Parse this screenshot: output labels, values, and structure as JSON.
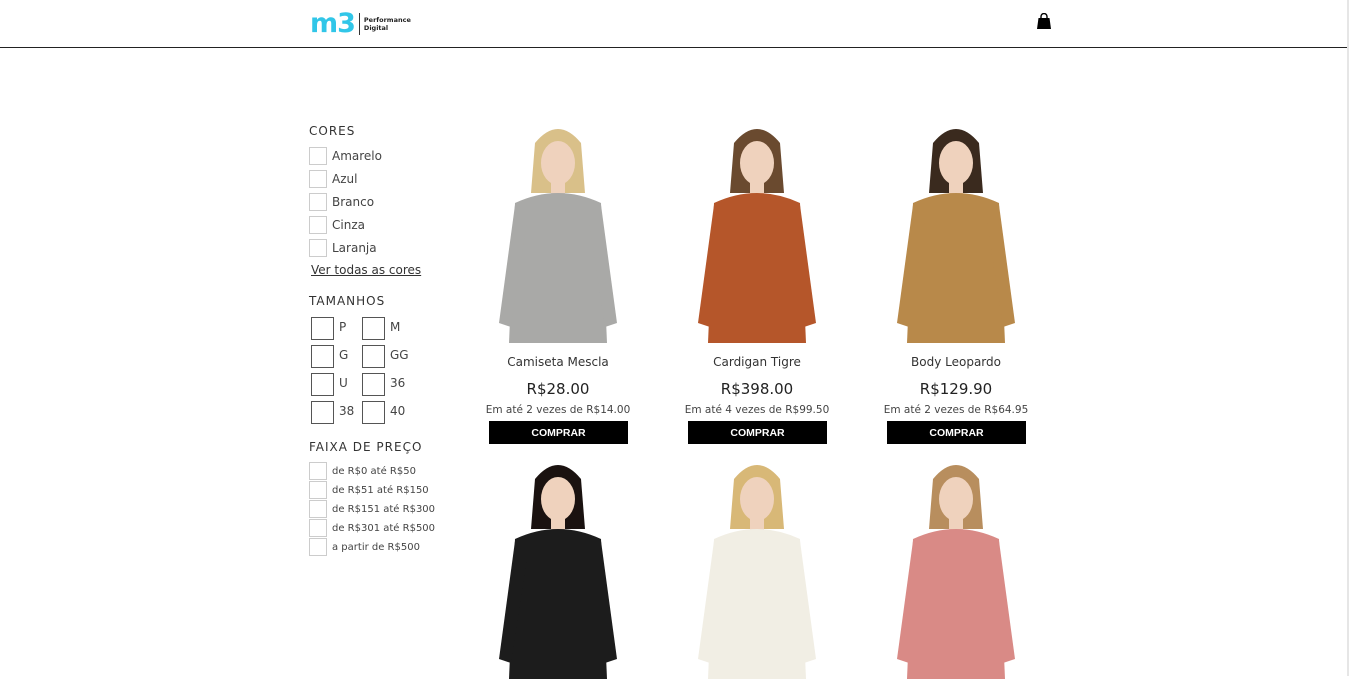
{
  "header": {
    "logo_mark": "m3",
    "logo_text_line1": "Performance",
    "logo_text_line2": "Digital",
    "cart_icon": "shopping-bag-icon"
  },
  "filters": {
    "colors": {
      "title": "CORES",
      "items": [
        "Amarelo",
        "Azul",
        "Branco",
        "Cinza",
        "Laranja"
      ],
      "see_all": "Ver todas as cores"
    },
    "sizes": {
      "title": "TAMANHOS",
      "items": [
        "P",
        "M",
        "G",
        "GG",
        "U",
        "36",
        "38",
        "40"
      ]
    },
    "price": {
      "title": "FAIXA DE PREÇO",
      "items": [
        "de R$0 até R$50",
        "de R$51 até R$150",
        "de R$151 até R$300",
        "de R$301 até R$500",
        "a partir de R$500"
      ]
    }
  },
  "products": [
    {
      "name": "Camiseta Mescla",
      "price": "R$28.00",
      "installments": "Em até 2 vezes de R$14.00",
      "button": "COMPRAR",
      "garment_color": "#a9a9a7"
    },
    {
      "name": "Cardigan Tigre",
      "price": "R$398.00",
      "installments": "Em até 4 vezes de R$99.50",
      "button": "COMPRAR",
      "garment_color": "#b5562a"
    },
    {
      "name": "Body Leopardo",
      "price": "R$129.90",
      "installments": "Em até 2 vezes de R$64.95",
      "button": "COMPRAR",
      "garment_color": "#b8894a"
    },
    {
      "name": "",
      "price": "",
      "installments": "",
      "button": "",
      "garment_color": "#1c1c1c"
    },
    {
      "name": "",
      "price": "",
      "installments": "",
      "button": "",
      "garment_color": "#f1eee4"
    },
    {
      "name": "",
      "price": "",
      "installments": "",
      "button": "",
      "garment_color": "#d98a86"
    }
  ],
  "colors": {
    "brand": "#31c6e8",
    "button_bg": "#000000",
    "button_text": "#ffffff"
  }
}
